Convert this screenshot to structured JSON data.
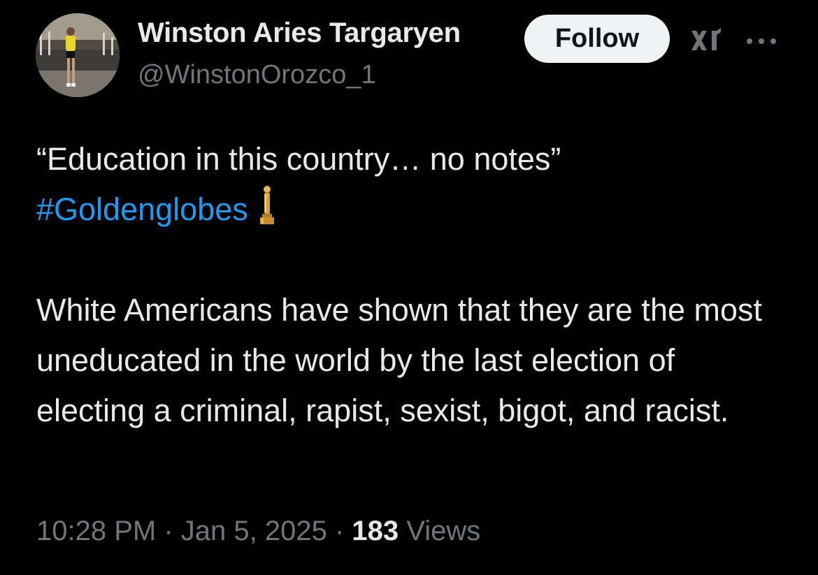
{
  "author": {
    "display_name": "Winston Aries Targaryen",
    "handle": "@WinstonOrozco_1",
    "avatar": "profile-photo"
  },
  "follow_label": "Follow",
  "icons": {
    "grok": "xai-grok-icon",
    "more": "more-horizontal-icon",
    "award": "golden-globe-trophy-icon"
  },
  "tweet": {
    "line1": "“Education in this country… no notes”",
    "hashtag": "#Goldenglobes",
    "body": "White Americans have shown that they are the most uneducated in the world by the last election of electing a criminal, rapist, sexist, bigot, and racist."
  },
  "meta": {
    "time": "10:28 PM",
    "sep1": " · ",
    "date": "Jan 5, 2025",
    "sep2": " · ",
    "views_count": "183",
    "views_label": " Views"
  },
  "colors": {
    "background": "#000000",
    "text": "#e7e9ea",
    "secondary": "#71767b",
    "link": "#1d9bf0",
    "button_bg": "#eff3f4"
  }
}
